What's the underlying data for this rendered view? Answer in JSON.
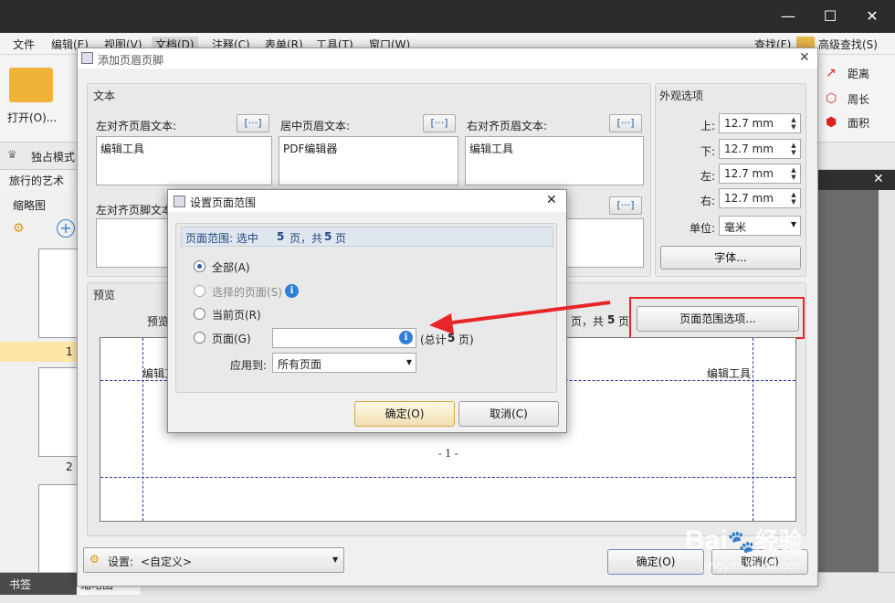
{
  "window": {
    "minimize": "—",
    "maximize": "☐",
    "close": "✕"
  },
  "menubar": {
    "items": [
      "文件",
      "编辑(E)",
      "视图(V)",
      "文档(D)",
      "注释(C)",
      "表单(R)",
      "工具(T)",
      "窗口(W)"
    ],
    "find": "查找(F)",
    "advanced_find": "高级查找(S)"
  },
  "ribbon": {
    "open": "打开(O)...",
    "distance": "距离",
    "perimeter": "周长",
    "area": "面积"
  },
  "modebar": {
    "exclusive_mode": "独占模式"
  },
  "doctab": {
    "name": "旅行的艺术读"
  },
  "leftpane": {
    "title": "缩略图",
    "page1": "1",
    "page2": "2"
  },
  "bottombar": {
    "bookmarks_tab": "书签",
    "thumbnails_tab": "缩略图"
  },
  "main_dialog": {
    "title": "添加页眉页脚",
    "text_group": "文本",
    "left_header_label": "左对齐页眉文本:",
    "left_header_value": "编辑工具",
    "center_header_label": "居中页眉文本:",
    "center_header_value": "PDF编辑器",
    "right_header_label": "右对齐页眉文本:",
    "right_header_value": "编辑工具",
    "left_footer_label": "左对齐页脚文本",
    "macro_glyph": "[···]",
    "appearance_group": "外观选项",
    "top_label": "上:",
    "top_value": "12.7 mm",
    "bottom_label": "下:",
    "bottom_value": "12.7 mm",
    "left_label": "左:",
    "left_value": "12.7 mm",
    "right_label": "右:",
    "right_value": "12.7 mm",
    "unit_label": "单位:",
    "unit_value": "毫米",
    "font_button": "字体...",
    "preview_group": "预览",
    "preview_label": "预览",
    "page_info_suffix": "页，共",
    "page_count": "5",
    "page_info_end": "页",
    "page_range_button": "页面范围选项...",
    "preview_left_header": "编辑工",
    "preview_right_header": "编辑工具",
    "preview_page_number": "- 1 -",
    "settings_label": "设置:",
    "settings_value": "<自定义>",
    "ok_button": "确定(O)",
    "cancel_button": "取消(C)"
  },
  "sub_dialog": {
    "title": "设置页面范围",
    "range_prefix": "页面范围: 选中",
    "selected_count": "5",
    "range_mid": "页，共",
    "total_count": "5",
    "range_end": "页",
    "opt_all": "全部(A)",
    "opt_selected": "选择的页面(S)",
    "opt_current": "当前页(R)",
    "opt_pages": "页面(G)",
    "pages_value": "",
    "total_prefix": "(总计",
    "total_pages": "5",
    "total_suffix": "页)",
    "apply_label": "应用到:",
    "apply_value": "所有页面",
    "ok_button": "确定(O)",
    "cancel_button": "取消(C)"
  },
  "watermark": {
    "brand": "Bai",
    "suffix": "经验",
    "url": "jingyan.baidu.com"
  },
  "colors": {
    "highlight_box": "#e8262a",
    "arrow": "#e8262a",
    "accent": "#2a5aa8"
  }
}
